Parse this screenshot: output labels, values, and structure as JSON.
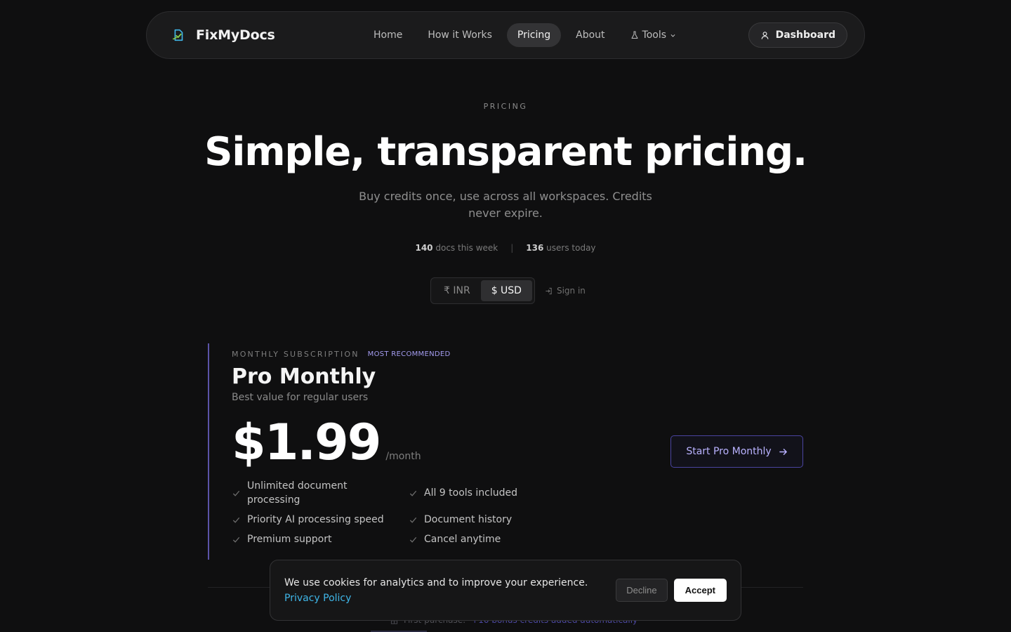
{
  "nav": {
    "brand": "FixMyDocs",
    "links": [
      {
        "label": "Home"
      },
      {
        "label": "How it Works"
      },
      {
        "label": "Pricing",
        "active": true
      },
      {
        "label": "About"
      },
      {
        "label": "Tools"
      }
    ],
    "dashboard_label": "Dashboard"
  },
  "hero": {
    "eyebrow": "PRICING",
    "title": "Simple, transparent pricing.",
    "subtitle": "Buy credits once, use across all workspaces. Credits never expire."
  },
  "stats": {
    "docs_count": "140",
    "docs_label": "docs this week",
    "separator": "|",
    "users_count": "136",
    "users_label": "users today"
  },
  "currency": {
    "options": [
      "₹ INR",
      "$ USD"
    ],
    "selected": "$ USD",
    "signin_label": "Sign in"
  },
  "plan": {
    "type": "MONTHLY SUBSCRIPTION",
    "badge": "MOST RECOMMENDED",
    "name": "Pro Monthly",
    "description": "Best value for regular users",
    "price": "$1.99",
    "period": "/month",
    "cta_label": "Start Pro Monthly",
    "features": [
      "Unlimited document processing",
      "All 9 tools included",
      "Priority AI processing speed",
      "Document history",
      "Premium support",
      "Cancel anytime"
    ]
  },
  "below_fold": {
    "label": "First purchase:",
    "highlight": "+10 bonus credits added automatically"
  },
  "cookie": {
    "text": "We use cookies for analytics and to improve your experience.",
    "link": "Privacy Policy",
    "decline": "Decline",
    "accept": "Accept"
  },
  "colors": {
    "background": "#0f0f10",
    "accent": "#5b54a8",
    "link": "#3fb6e8"
  }
}
